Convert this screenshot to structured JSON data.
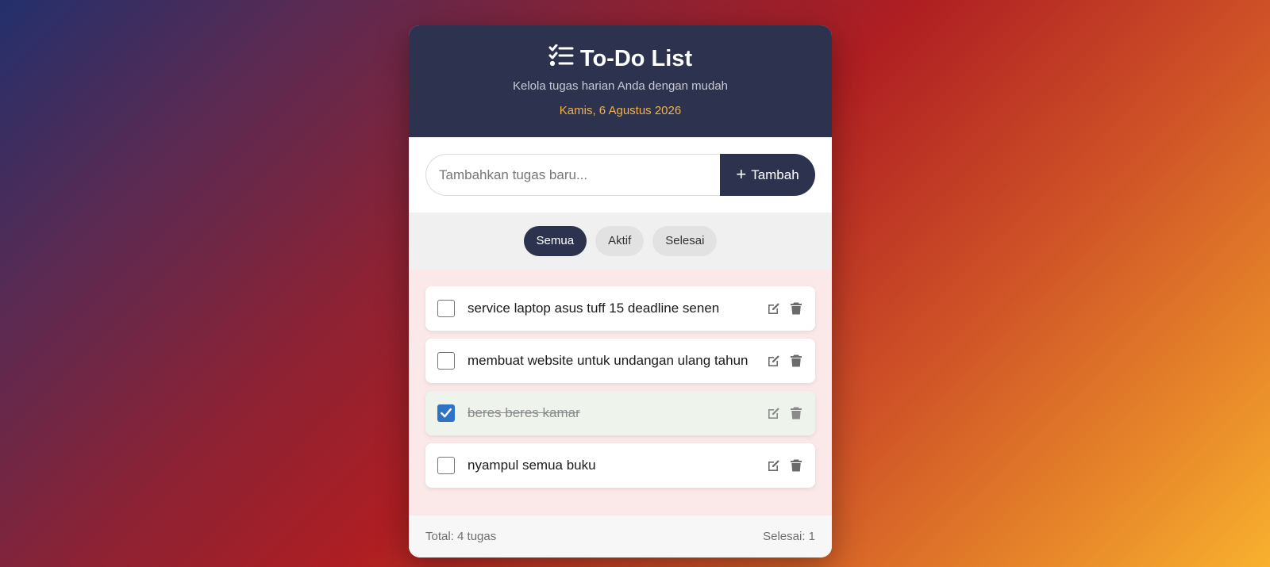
{
  "header": {
    "title": "To-Do List",
    "subtitle": "Kelola tugas harian Anda dengan mudah",
    "date": "Kamis, 6 Agustus 2026",
    "title_icon": "checklist-icon"
  },
  "input": {
    "placeholder": "Tambahkan tugas baru...",
    "value": "",
    "add_label": "Tambah",
    "add_icon": "plus-icon"
  },
  "filters": [
    {
      "label": "Semua",
      "active": true
    },
    {
      "label": "Aktif",
      "active": false
    },
    {
      "label": "Selesai",
      "active": false
    }
  ],
  "tasks": [
    {
      "text": "service laptop asus tuff 15 deadline senen",
      "done": false
    },
    {
      "text": "membuat website untuk undangan ulang tahun",
      "done": false
    },
    {
      "text": "beres beres kamar",
      "done": true
    },
    {
      "text": "nyampul semua buku",
      "done": false
    }
  ],
  "footer": {
    "total": "Total: 4 tugas",
    "completed": "Selesai: 1"
  },
  "colors": {
    "header_bg": "#2d334e",
    "date_accent": "#f1b24a",
    "checkbox_checked": "#2f73c8"
  }
}
